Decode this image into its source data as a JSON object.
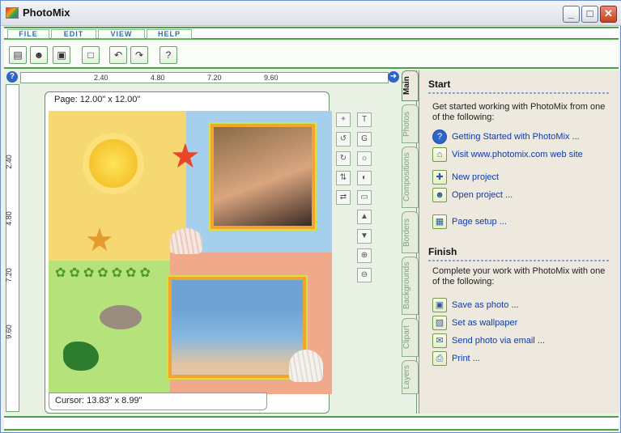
{
  "window": {
    "title": "PhotoMix",
    "controls": [
      "_",
      "□",
      "✕"
    ]
  },
  "menu": [
    {
      "label": "FILE"
    },
    {
      "label": "EDIT"
    },
    {
      "label": "VIEW"
    },
    {
      "label": "HELP"
    }
  ],
  "toolbar": [
    {
      "icon": "new-project-icon",
      "glyph": "▤"
    },
    {
      "icon": "open-project-icon",
      "glyph": "☻"
    },
    {
      "icon": "save-project-icon",
      "glyph": "▣"
    },
    {
      "icon": "page-setup-icon",
      "glyph": "□"
    },
    {
      "icon": "undo-icon",
      "glyph": "↶"
    },
    {
      "icon": "redo-icon",
      "glyph": "↷"
    },
    {
      "icon": "help-icon",
      "glyph": "?"
    }
  ],
  "ruler": {
    "h_labels": [
      "2.40",
      "4.80",
      "7.20",
      "9.60"
    ],
    "v_labels": [
      "2.40",
      "4.80",
      "7.20",
      "9.60"
    ]
  },
  "canvas": {
    "page_label": "Page: 12.00\" x 12.00\"",
    "cursor_label": "Cursor: 13.83\" x 8.99\""
  },
  "side_tabs": [
    "Main",
    "Photos",
    "Compositions",
    "Borders",
    "Backgrounds",
    "Clipart",
    "Layers"
  ],
  "panel": {
    "start": {
      "title": "Start",
      "desc": "Get started working with PhotoMix from one of the following:",
      "links": [
        {
          "label": "Getting Started with PhotoMix ...",
          "icon": "help-icon",
          "glyph": "?"
        },
        {
          "label": "Visit www.photomix.com web site",
          "icon": "home-icon",
          "glyph": "⌂"
        },
        {
          "label": "New project",
          "icon": "new-project-icon",
          "glyph": "✚"
        },
        {
          "label": "Open project ...",
          "icon": "open-project-icon",
          "glyph": "☻"
        },
        {
          "label": "Page setup ...",
          "icon": "page-setup-icon",
          "glyph": "▦"
        }
      ]
    },
    "finish": {
      "title": "Finish",
      "desc": "Complete your work with PhotoMix with one of the following:",
      "links": [
        {
          "label": "Save as photo ...",
          "icon": "save-photo-icon",
          "glyph": "▣"
        },
        {
          "label": "Set as wallpaper",
          "icon": "wallpaper-icon",
          "glyph": "▧"
        },
        {
          "label": "Send photo via email ...",
          "icon": "email-icon",
          "glyph": "✉"
        },
        {
          "label": "Print ...",
          "icon": "print-icon",
          "glyph": "⎙"
        }
      ]
    }
  }
}
